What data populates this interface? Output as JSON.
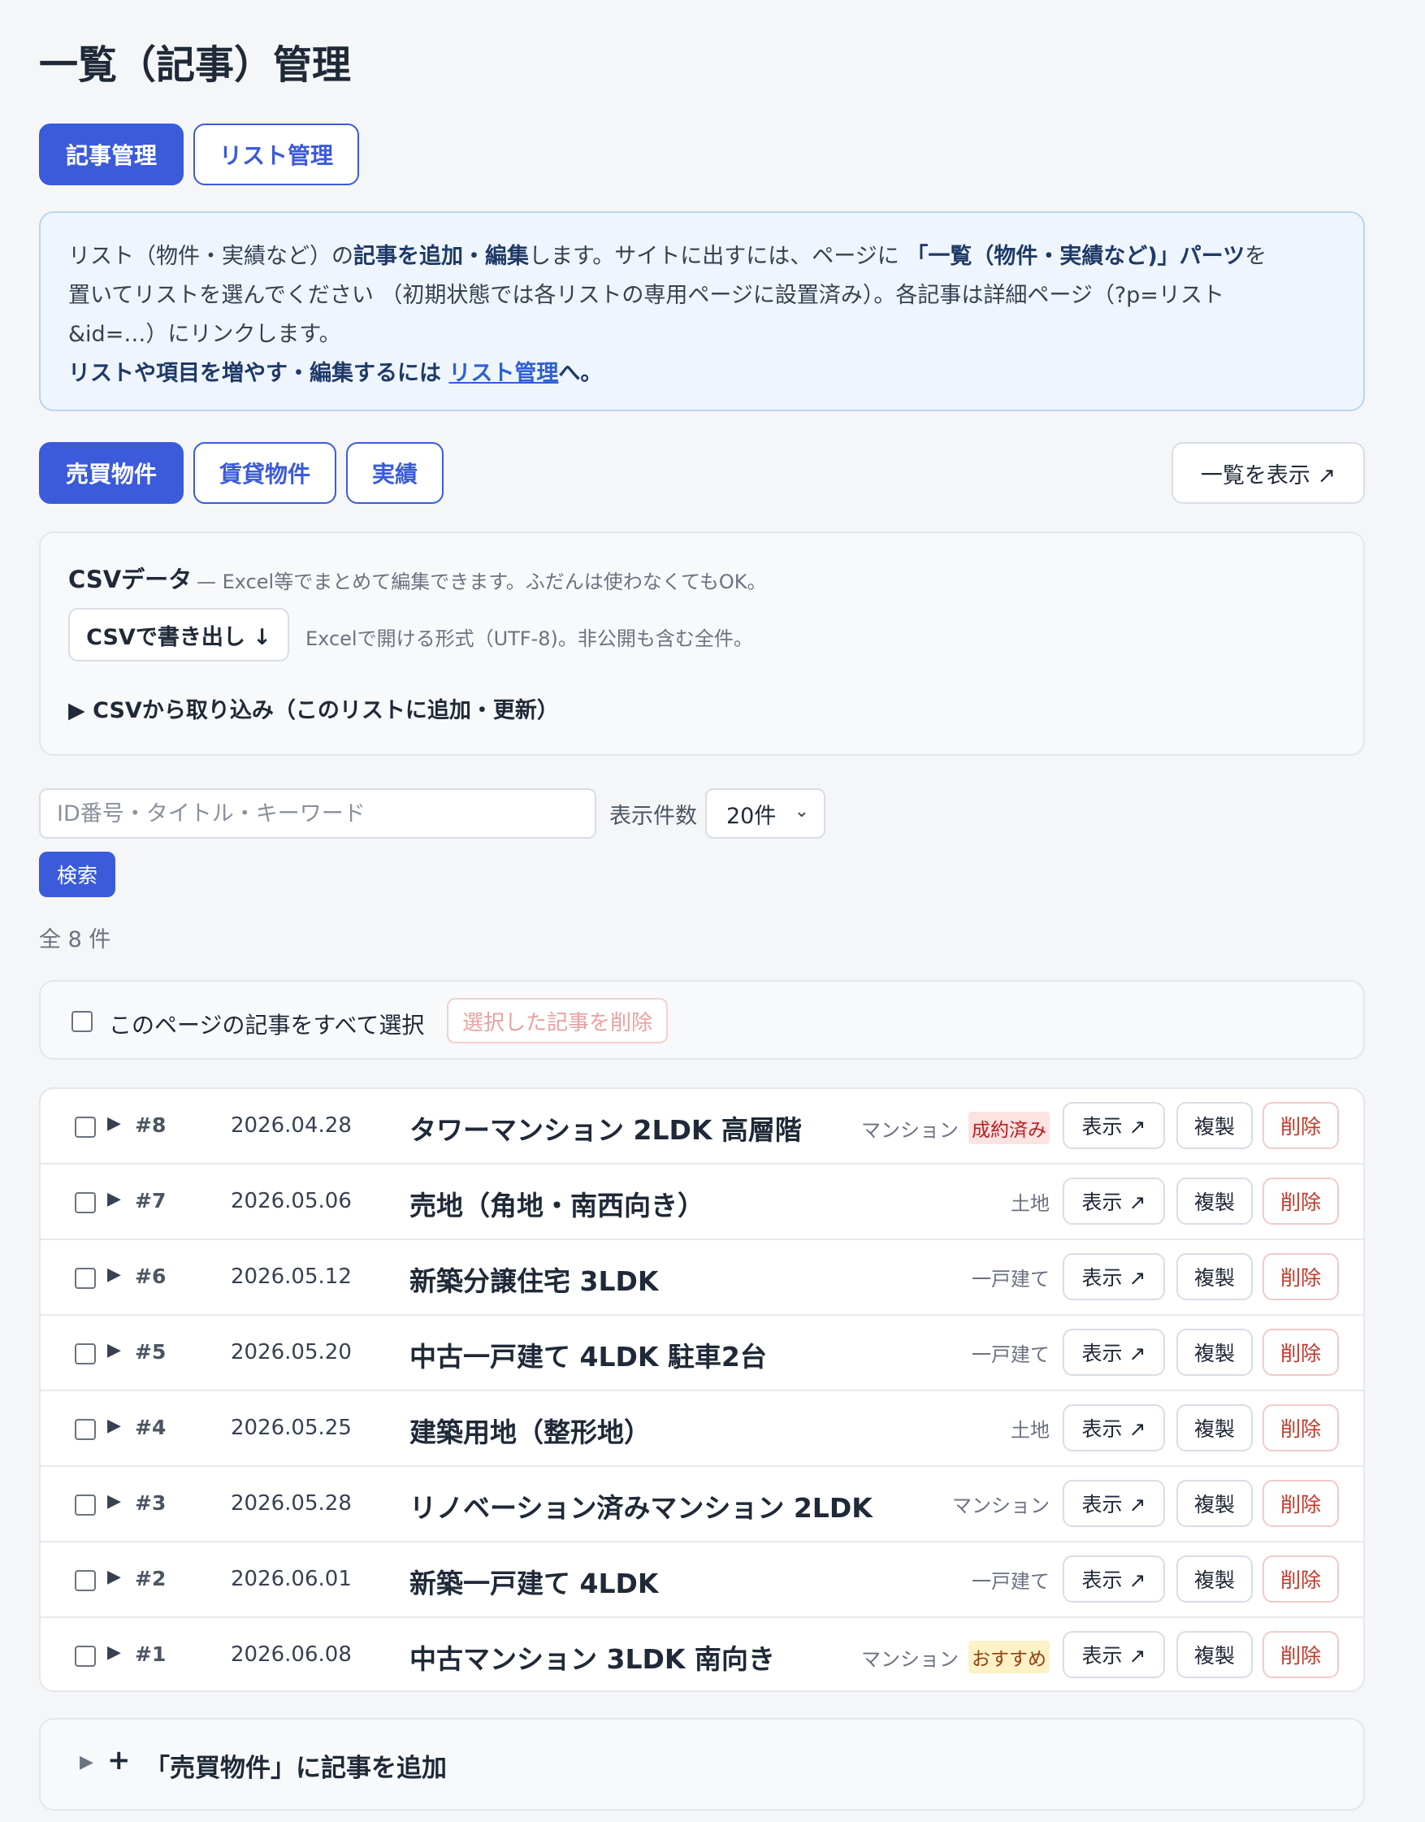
{
  "page_title": "一覧（記事）管理",
  "top_tabs": [
    {
      "label": "記事管理",
      "active": true
    },
    {
      "label": "リスト管理",
      "active": false
    }
  ],
  "info": {
    "line1_a": "リスト（物件・実績など）の",
    "line1_b": "記事を追加・編集",
    "line1_c": "します。サイトに出すには、ページに ",
    "line1_d": "「一覧（物件・実績など)」パーツ",
    "line1_e": "を",
    "line2": "置いてリストを選んでください （初期状態では各リストの専用ページに設置済み）。各記事は詳細ページ（?p=リスト",
    "line3": "&id=…）にリンクします。",
    "line4_a": "リストや項目を増やす・編集するには ",
    "line4_link": "リスト管理",
    "line4_b": "へ。"
  },
  "list_tabs": [
    {
      "label": "売買物件",
      "active": true
    },
    {
      "label": "賃貸物件",
      "active": false
    },
    {
      "label": "実績",
      "active": false
    }
  ],
  "view_list_button": "一覧を表示 ↗",
  "csv": {
    "title": "CSVデータ",
    "subtitle": "— Excel等でまとめて編集できます。ふだんは使わなくてもOK。",
    "export_button": "CSVで書き出し ↓",
    "export_note": "Excelで開ける形式（UTF-8)。非公開も含む全件。",
    "import_toggle": "▶ CSVから取り込み（このリストに追加・更新）"
  },
  "search": {
    "placeholder": "ID番号・タイトル・キーワード",
    "per_page_label": "表示件数",
    "per_page_value": "20件",
    "button": "検索"
  },
  "total_count": "全 8 件",
  "bulk": {
    "select_all_label": "このページの記事をすべて選択",
    "delete_selected": "選択した記事を削除"
  },
  "row_actions": {
    "view": "表示 ↗",
    "duplicate": "複製",
    "delete": "削除"
  },
  "articles": [
    {
      "id": "#8",
      "date": "2026.04.28",
      "title": "タワーマンション 2LDK 高層階",
      "category": "マンション",
      "badge": "成約済み",
      "badge_type": "sold"
    },
    {
      "id": "#7",
      "date": "2026.05.06",
      "title": "売地（角地・南西向き）",
      "category": "土地",
      "badge": "",
      "badge_type": ""
    },
    {
      "id": "#6",
      "date": "2026.05.12",
      "title": "新築分譲住宅 3LDK",
      "category": "一戸建て",
      "badge": "",
      "badge_type": ""
    },
    {
      "id": "#5",
      "date": "2026.05.20",
      "title": "中古一戸建て 4LDK 駐車2台",
      "category": "一戸建て",
      "badge": "",
      "badge_type": ""
    },
    {
      "id": "#4",
      "date": "2026.05.25",
      "title": "建築用地（整形地）",
      "category": "土地",
      "badge": "",
      "badge_type": ""
    },
    {
      "id": "#3",
      "date": "2026.05.28",
      "title": "リノベーション済みマンション 2LDK",
      "category": "マンション",
      "badge": "",
      "badge_type": ""
    },
    {
      "id": "#2",
      "date": "2026.06.01",
      "title": "新築一戸建て 4LDK",
      "category": "一戸建て",
      "badge": "",
      "badge_type": ""
    },
    {
      "id": "#1",
      "date": "2026.06.08",
      "title": "中古マンション 3LDK 南向き",
      "category": "マンション",
      "badge": "おすすめ",
      "badge_type": "rec"
    }
  ],
  "add_article": {
    "label": "「売買物件」に記事を追加"
  }
}
